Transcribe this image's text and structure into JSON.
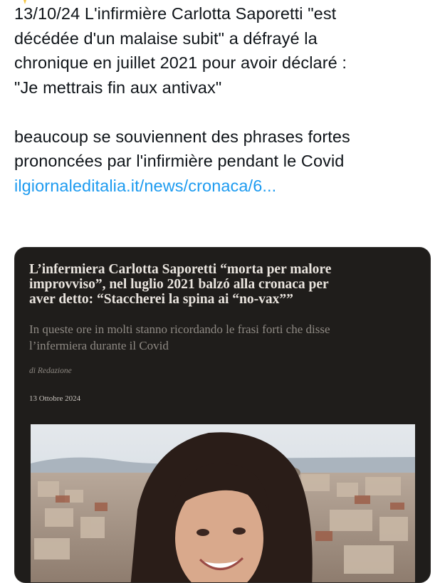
{
  "tweet": {
    "lines": [
      "13/10/24 L'infirmière  Carlotta Saporetti \"est",
      "décédée d'un malaise subit\" a défrayé la",
      "chronique en juillet 2021 pour avoir déclaré :",
      "\"Je mettrais fin aux antivax\""
    ],
    "lines2": [
      "beaucoup se souviennent des phrases fortes",
      "prononcées par l'infirmière pendant le Covid"
    ],
    "link_text": "ilgiornaleditalia.it/news/cronaca/6..."
  },
  "card": {
    "headline_lines": [
      "L’infermiera Carlotta Saporetti “morta per malore",
      "improvviso”, nel luglio 2021 balzó alla cronaca per",
      "aver detto: “Staccherei la spina ai “no-vax””"
    ],
    "subtitle_lines": [
      "In queste ore in molti stanno ricordando le frasi forti che disse",
      "l’infermiera durante il Covid"
    ],
    "author": "di Redazione",
    "date": "13 Ottobre 2024"
  },
  "colors": {
    "link": "#1d9bf0",
    "text": "#0f1419",
    "card_bg": "#1f1d1b"
  }
}
